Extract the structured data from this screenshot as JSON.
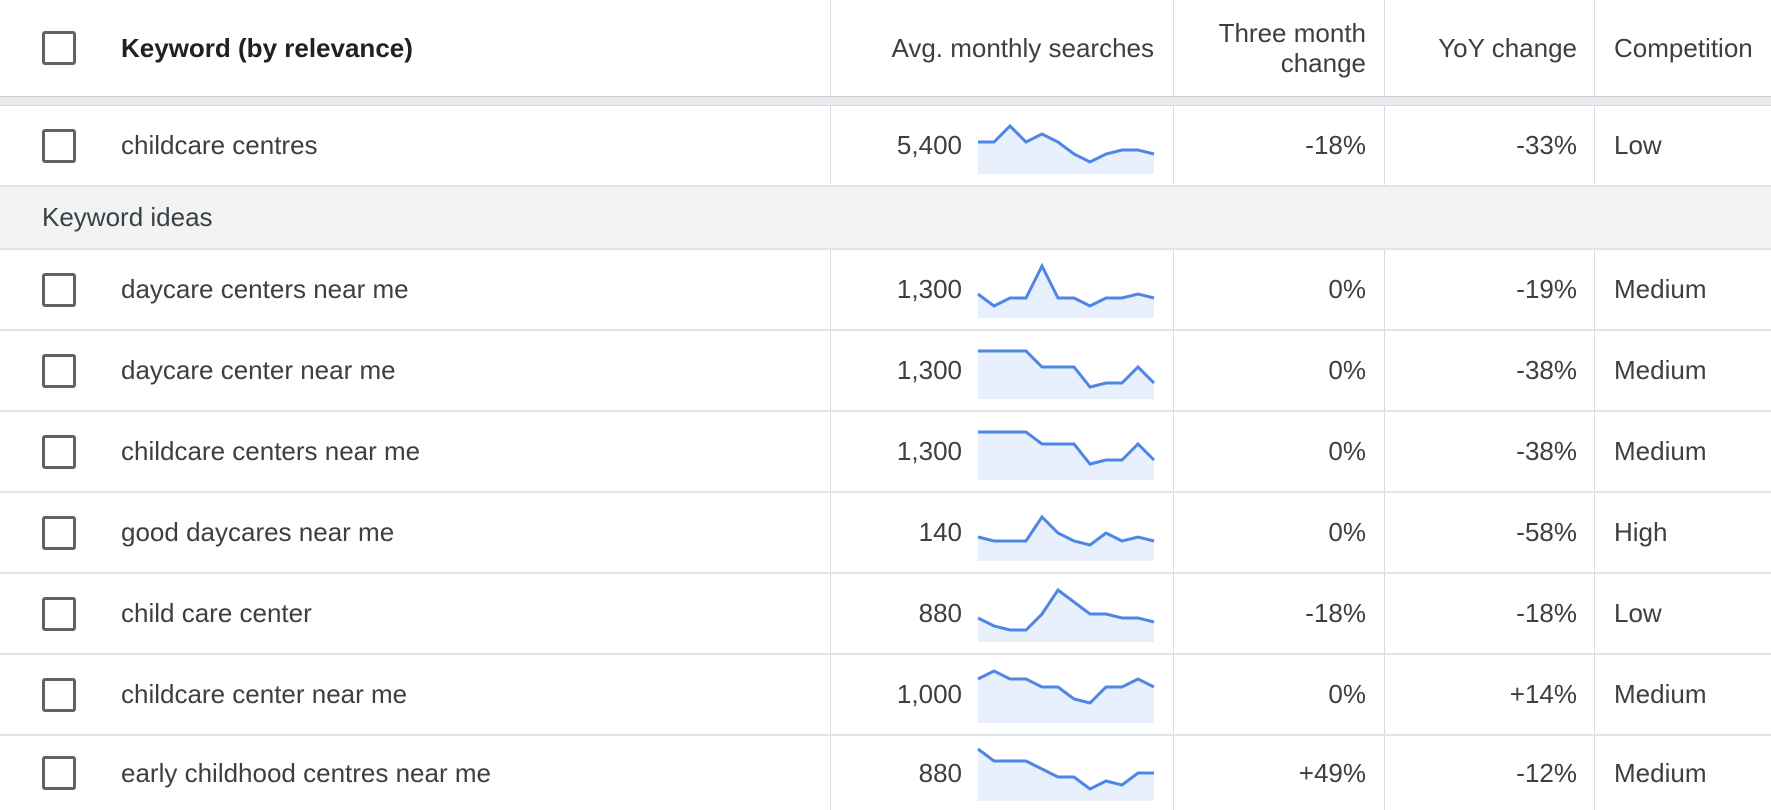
{
  "columns": {
    "keyword": "Keyword (by relevance)",
    "avg": "Avg. monthly searches",
    "three_month_line1": "Three month",
    "three_month_line2": "change",
    "yoy": "YoY change",
    "competition": "Competition"
  },
  "primary": {
    "keyword": "childcare centres",
    "avg": "5,400",
    "three": "-18%",
    "yoy": "-33%",
    "competition": "Low",
    "trend": [
      5,
      5,
      9,
      5,
      7,
      5,
      2,
      0,
      2,
      3,
      3,
      2
    ]
  },
  "section_label": "Keyword ideas",
  "ideas": [
    {
      "keyword": "daycare centers near me",
      "avg": "1,300",
      "three": "0%",
      "yoy": "-19%",
      "competition": "Medium",
      "trend": [
        3,
        0,
        2,
        2,
        10,
        2,
        2,
        0,
        2,
        2,
        3,
        2
      ]
    },
    {
      "keyword": "daycare center near me",
      "avg": "1,300",
      "three": "0%",
      "yoy": "-38%",
      "competition": "Medium",
      "trend": [
        9,
        9,
        9,
        9,
        5,
        5,
        5,
        0,
        1,
        1,
        5,
        1
      ]
    },
    {
      "keyword": "childcare centers near me",
      "avg": "1,300",
      "three": "0%",
      "yoy": "-38%",
      "competition": "Medium",
      "trend": [
        9,
        9,
        9,
        9,
        6,
        6,
        6,
        1,
        2,
        2,
        6,
        2
      ]
    },
    {
      "keyword": "good daycares near me",
      "avg": "140",
      "three": "0%",
      "yoy": "-58%",
      "competition": "High",
      "trend": [
        3,
        2,
        2,
        2,
        8,
        4,
        2,
        1,
        4,
        2,
        3,
        2
      ]
    },
    {
      "keyword": "child care center",
      "avg": "880",
      "three": "-18%",
      "yoy": "-18%",
      "competition": "Low",
      "trend": [
        3,
        1,
        0,
        0,
        4,
        10,
        7,
        4,
        4,
        3,
        3,
        2
      ]
    },
    {
      "keyword": "childcare center near me",
      "avg": "1,000",
      "three": "0%",
      "yoy": "+14%",
      "competition": "Medium",
      "trend": [
        8,
        10,
        8,
        8,
        6,
        6,
        3,
        2,
        6,
        6,
        8,
        6
      ]
    },
    {
      "keyword": "early childhood centres near me",
      "avg": "880",
      "three": "+49%",
      "yoy": "-12%",
      "competition": "Medium",
      "trend": [
        10,
        7,
        7,
        7,
        5,
        3,
        3,
        0,
        2,
        1,
        4,
        4
      ]
    }
  ],
  "colors": {
    "spark_line": "#4f86e5",
    "spark_fill": "#e8f0fd"
  }
}
